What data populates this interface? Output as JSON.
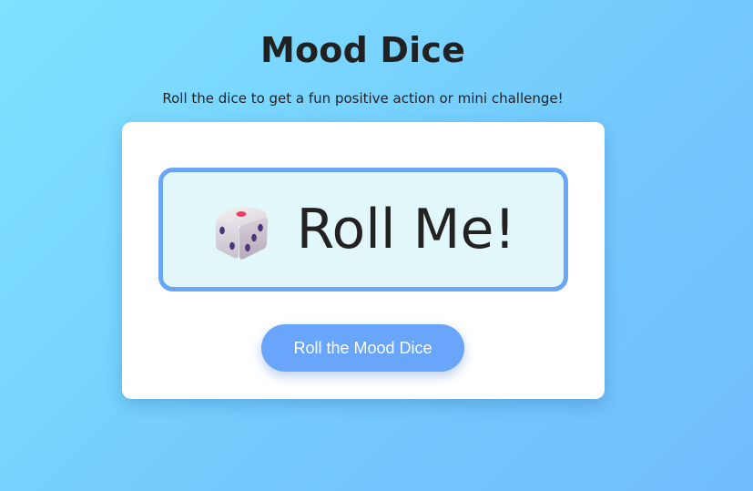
{
  "header": {
    "title": "Mood Dice",
    "subtitle": "Roll the dice to get a fun positive action or mini challenge!"
  },
  "result": {
    "icon": "dice-icon",
    "text": "Roll Me!"
  },
  "actions": {
    "roll_label": "Roll the Mood Dice"
  },
  "colors": {
    "accent": "#69a6fb",
    "result_border": "#6aa6f8",
    "result_background": "#e1f7f9"
  }
}
